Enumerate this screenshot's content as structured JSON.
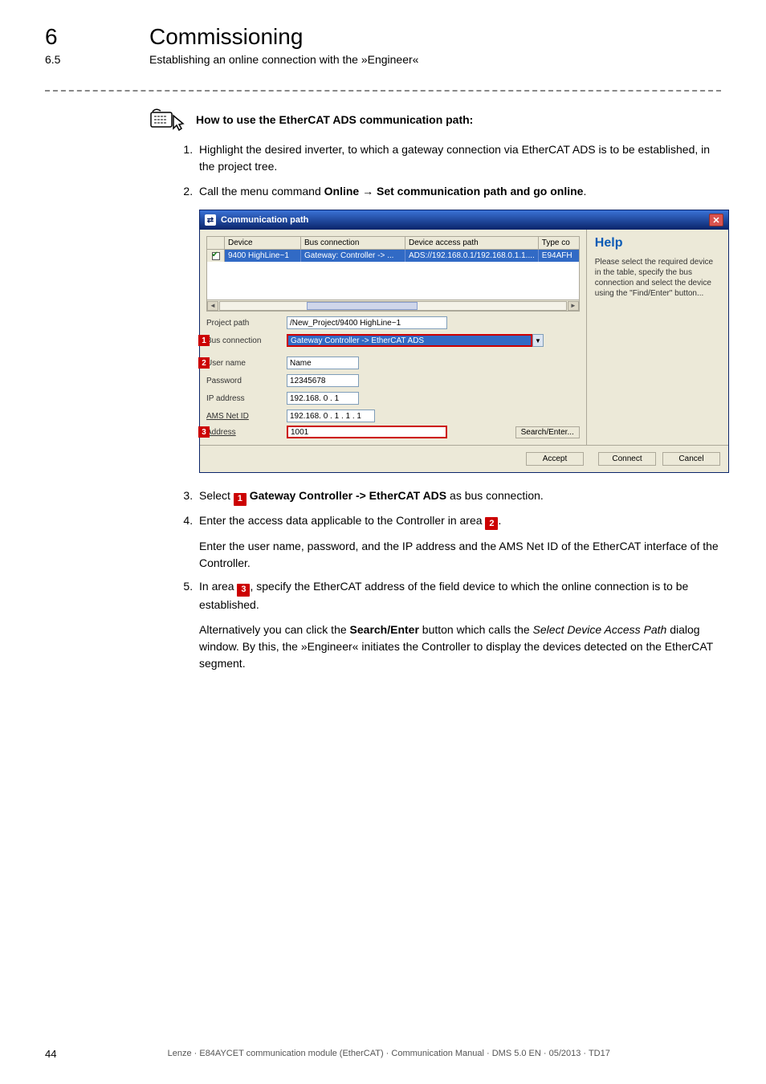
{
  "chapter": {
    "num": "6",
    "title": "Commissioning"
  },
  "section": {
    "num": "6.5",
    "title": "Establishing an online connection with the »Engineer«"
  },
  "howto": {
    "heading": "How to use the EtherCAT ADS communication path:"
  },
  "steps_a": {
    "s1": "Highlight the desired inverter, to which a gateway connection via EtherCAT ADS is to be established, in the project tree.",
    "s2_pre": "Call the menu command ",
    "s2_b1": "Online",
    "s2_arrow": " → ",
    "s2_b2": "Set communication path and go online",
    "s2_post": "."
  },
  "dialog": {
    "title": "Communication path",
    "help_h": "Help",
    "help_p": "Please select the required device in the table, specify the bus connection and select the device using the \"Find/Enter\" button...",
    "grid": {
      "h_device": "Device",
      "h_bus": "Bus connection",
      "h_path": "Device access path",
      "h_type": "Type co",
      "r_device": "9400 HighLine~1",
      "r_bus": "Gateway: Controller -> ...",
      "r_path": "ADS://192.168.0.1/192.168.0.1.1....",
      "r_type": "E94AFH"
    },
    "labels": {
      "project_path": "Project path",
      "bus_conn": "Bus connection",
      "user": "User name",
      "pass": "Password",
      "ip": "IP address",
      "ams": "AMS Net ID",
      "addr": "Address"
    },
    "values": {
      "project_path": "/New_Project/9400 HighLine~1",
      "bus_conn": "Gateway Controller -> EtherCAT ADS",
      "user": "Name",
      "pass": "12345678",
      "ip": "192.168. 0 . 1",
      "ams": "192.168. 0 . 1 . 1 . 1",
      "addr": "1001"
    },
    "buttons": {
      "search": "Search/Enter...",
      "accept": "Accept",
      "connect": "Connect",
      "cancel": "Cancel"
    }
  },
  "steps_b": {
    "s3_pre": "Select ",
    "s3_label": "1",
    "s3_b": " Gateway Controller -> EtherCAT ADS",
    "s3_post": " as bus connection.",
    "s4_pre": "Enter the access data applicable to the Controller in area ",
    "s4_label": "2",
    "s4_post": ".",
    "s4_para": "Enter the user name, password, and the IP address and the AMS Net ID of the EtherCAT interface of the Controller.",
    "s5_pre": "In area ",
    "s5_label": "3",
    "s5_post": ", specify the EtherCAT address of the field device to which the online connection is to be established.",
    "s5_para_a": "Alternatively you can click the ",
    "s5_b1": "Search/Enter",
    "s5_para_b": " button which calls the ",
    "s5_i1": "Select Device Access Path",
    "s5_para_c": " dialog window. By this, the »Engineer« initiates the Controller to display the devices detected on the EtherCAT segment."
  },
  "footer": {
    "page": "44",
    "text": "Lenze · E84AYCET communication module (EtherCAT) · Communication Manual · DMS 5.0 EN · 05/2013 · TD17"
  }
}
